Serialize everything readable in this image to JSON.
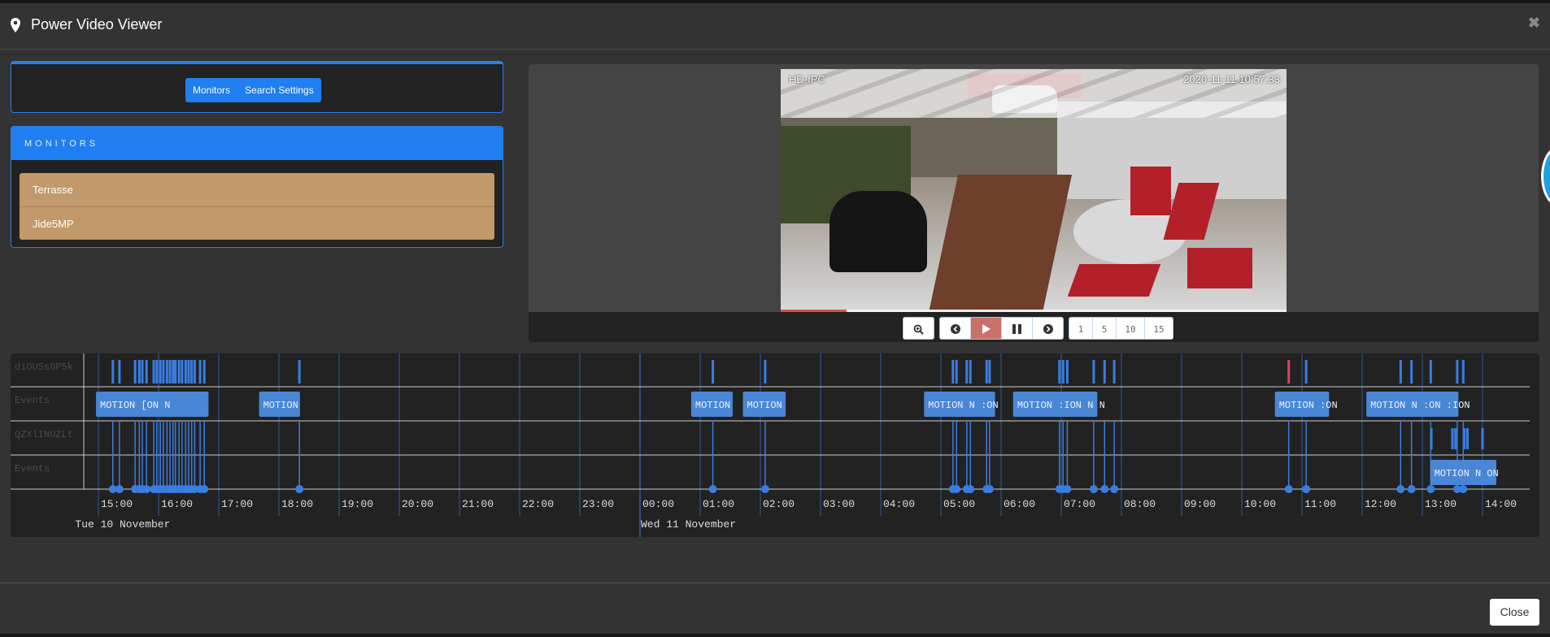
{
  "modal": {
    "title": "Power Video Viewer",
    "title_icon": "map-marker-icon",
    "close_icon": "close-icon",
    "close_label": "✖"
  },
  "tabs": {
    "items": [
      {
        "label": "Monitors"
      },
      {
        "label": "Search Settings"
      }
    ]
  },
  "monitors": {
    "heading": "MONITORS",
    "items": [
      {
        "label": "Terrasse"
      },
      {
        "label": "Jide5MP"
      }
    ]
  },
  "player": {
    "osd_left": "HD-IPC",
    "osd_right": "2020-11-11  10:57:33",
    "progress_percent": 13,
    "controls": {
      "zoom_icon": "zoom-in-icon",
      "prev_icon": "arrow-left-circle-icon",
      "play_icon": "play-icon",
      "pause_icon": "pause-icon",
      "next_icon": "arrow-right-circle-icon",
      "speeds": [
        "1",
        "5",
        "10",
        "15"
      ]
    },
    "colors": {
      "seek_fill": "#d9534f",
      "play_active": "#c9706a"
    }
  },
  "timeline": {
    "rows": [
      {
        "label": "diOUSsGP5k"
      },
      {
        "label": "Events"
      },
      {
        "label": "QZXlINUZLt"
      },
      {
        "label": "Events"
      }
    ],
    "hour_labels": [
      "15:00",
      "16:00",
      "17:00",
      "18:00",
      "19:00",
      "20:00",
      "21:00",
      "22:00",
      "23:00",
      "00:00",
      "01:00",
      "02:00",
      "03:00",
      "04:00",
      "05:00",
      "06:00",
      "07:00",
      "08:00",
      "09:00",
      "10:00",
      "11:00",
      "12:00",
      "13:00",
      "14:00"
    ],
    "day_labels": [
      {
        "label": "Tue 10 November",
        "hour": 14.6
      },
      {
        "label": "Wed 11 November",
        "hour": 24.0
      }
    ],
    "range_hours": [
      13.6,
      38.5
    ],
    "first_hour": 15,
    "event_label": "MOTION",
    "colors": {
      "event": "#3a7de0",
      "box": "#4a86d6",
      "current": "#d9435a",
      "grid": "#2f5aa0",
      "row_line": "#cccccc"
    },
    "monitor1_events_hours": [
      15.24,
      15.35,
      15.61,
      15.68,
      15.73,
      15.8,
      15.92,
      15.97,
      16.03,
      16.08,
      16.14,
      16.19,
      16.24,
      16.28,
      16.34,
      16.39,
      16.45,
      16.5,
      16.55,
      16.6,
      16.69,
      16.76,
      18.34,
      25.21,
      26.08,
      29.2,
      29.26,
      29.43,
      29.49,
      29.76,
      29.81,
      30.97,
      31.03,
      31.1,
      31.54,
      31.72,
      31.88
    ],
    "monitor1_current_hour": 34.78,
    "monitor1_more_events_hours": [
      35.07,
      36.64,
      36.82,
      37.14,
      37.58,
      37.68
    ],
    "monitor1_boxes": [
      {
        "start_hour": 14.96,
        "end_hour": 16.83,
        "text": "MOTION [ON  N"
      },
      {
        "start_hour": 17.67,
        "end_hour": 18.35,
        "text": "MOTION"
      },
      {
        "start_hour": 24.85,
        "end_hour": 25.54,
        "text": "MOTION"
      },
      {
        "start_hour": 25.71,
        "end_hour": 26.42,
        "text": "MOTION"
      },
      {
        "start_hour": 28.72,
        "end_hour": 29.9,
        "text": "MOTION N :ON"
      },
      {
        "start_hour": 30.2,
        "end_hour": 31.6,
        "text": "MOTION :ION N N"
      },
      {
        "start_hour": 34.55,
        "end_hour": 35.45,
        "text": "MOTION :ON"
      },
      {
        "start_hour": 36.07,
        "end_hour": 37.6,
        "text": "MOTION N :ON :ION"
      }
    ],
    "monitor2_events_hours": [
      37.15,
      37.5,
      37.55,
      37.7,
      37.75,
      38.0
    ],
    "monitor2_boxes": [
      {
        "start_hour": 37.13,
        "end_hour": 38.23,
        "text": "MOTION N  ON"
      }
    ]
  },
  "footer": {
    "close_label": "Close"
  }
}
